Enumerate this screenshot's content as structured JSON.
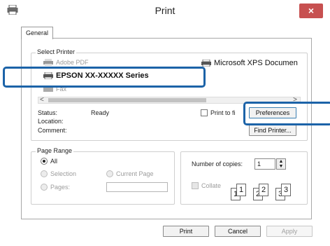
{
  "window": {
    "title": "Print",
    "close_glyph": "×",
    "app_icon": "printer-icon"
  },
  "tabs": [
    {
      "label": "General"
    }
  ],
  "select_printer": {
    "label": "Select Printer",
    "printers": [
      {
        "name": "Adobe PDF",
        "icon": "printer-icon"
      },
      {
        "name": "EPSON XX-XXXXX Series",
        "icon": "printer-icon"
      },
      {
        "name": "Fax",
        "icon": "fax-icon"
      },
      {
        "name": "Microsoft XPS Documen",
        "icon": "printer-icon"
      }
    ],
    "scroll_left": "<",
    "scroll_right": ">"
  },
  "status": {
    "status_label": "Status:",
    "status_value": "Ready",
    "location_label": "Location:",
    "comment_label": "Comment:",
    "print_to_file_label": "Print to fi",
    "preferences_label": "Preferences",
    "find_printer_label": "Find Printer..."
  },
  "page_range": {
    "label": "Page Range",
    "all_label": "All",
    "selection_label": "Selection",
    "current_page_label": "Current Page",
    "pages_label": "Pages:",
    "pages_value": ""
  },
  "copies": {
    "number_label": "Number of copies:",
    "number_value": "1",
    "collate_label": "Collate"
  },
  "collate_pages": [
    "1",
    "1",
    "2",
    "2",
    "3",
    "3"
  ],
  "footer": {
    "print_label": "Print",
    "cancel_label": "Cancel",
    "apply_label": "Apply"
  },
  "colors": {
    "highlight": "#1c63a8",
    "close_button": "#c75050"
  }
}
